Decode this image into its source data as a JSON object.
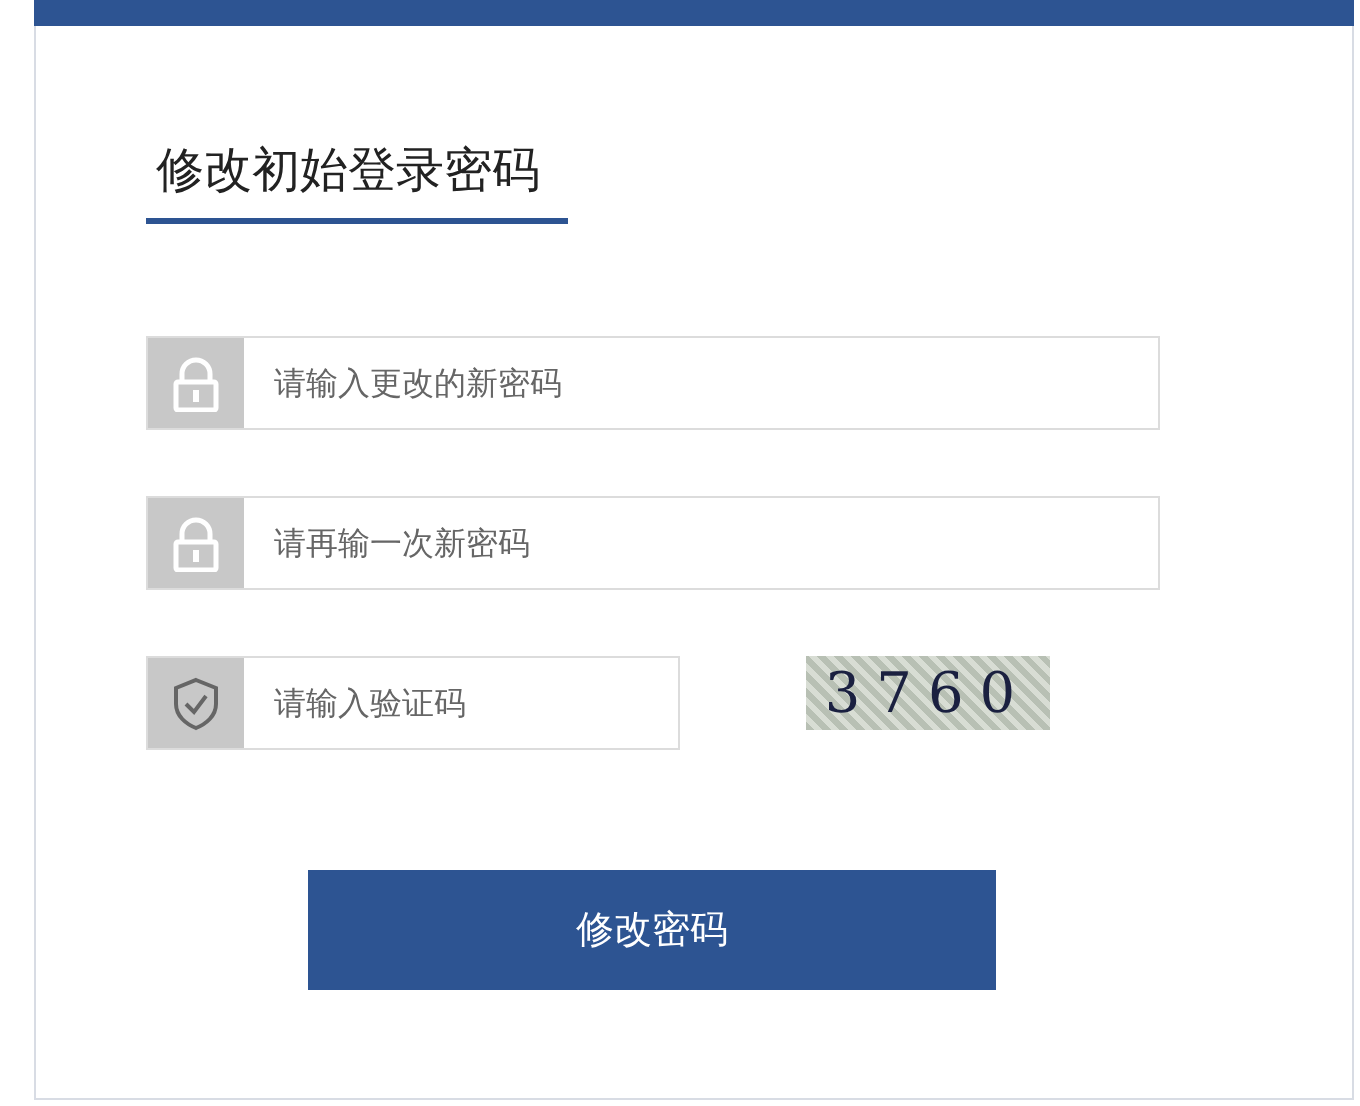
{
  "title": "修改初始登录密码",
  "fields": [
    {
      "kind": "lock",
      "placeholder": "请输入更改的新密码"
    },
    {
      "kind": "lock",
      "placeholder": "请再输一次新密码"
    },
    {
      "kind": "shield",
      "placeholder": "请输入验证码",
      "captcha": "3760"
    }
  ],
  "submit": "修改密码"
}
